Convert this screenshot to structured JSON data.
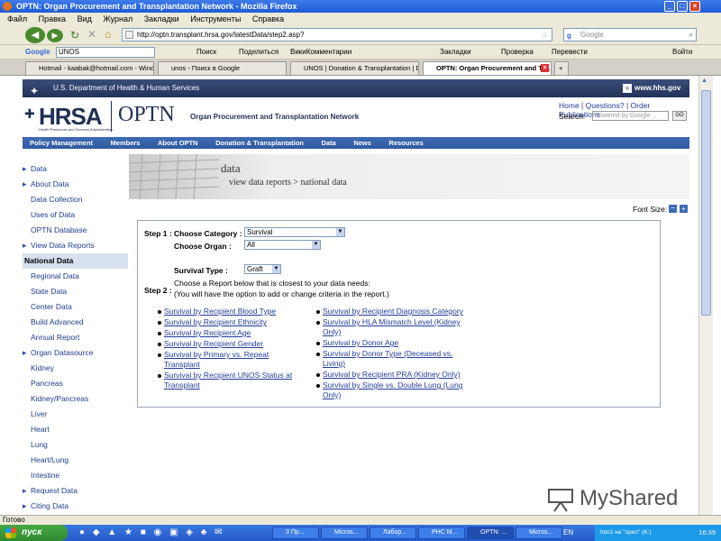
{
  "window": {
    "title": "OPTN: Organ Procurement and Transplantation Network - Mozilla Firefox"
  },
  "menu": [
    "Файл",
    "Правка",
    "Вид",
    "Журнал",
    "Закладки",
    "Инструменты",
    "Справка"
  ],
  "address": {
    "url": "http://optn.transplant.hrsa.gov/latestData/step2.asp?",
    "search_placeholder": "Google"
  },
  "googlebar": {
    "query": "UNOS",
    "items": [
      "Поиск",
      "Поделиться",
      "ВикиКомментарии",
      "Закладки",
      "Проверка",
      "Перевести",
      "Войти"
    ]
  },
  "tabs": [
    {
      "label": "Hotmail - kaabak@hotmail.com - Windo..."
    },
    {
      "label": "unos - Поиск в Google"
    },
    {
      "label": "UNOS | Donation & Transplantation | D..."
    },
    {
      "label": "OPTN: Organ Procurement and Tr..."
    }
  ],
  "hhs": {
    "left": "U.S. Department of Health & Human Services",
    "right": "www.hhs.gov"
  },
  "header": {
    "hrsa": "HRSA",
    "hrsa_sub": "Health Resources and Services Administration",
    "optn": "OPTN",
    "optn_full": "Organ Procurement and Transplantation Network",
    "links": "Home | Questions? | Order Publications",
    "search_label": "Search:",
    "search_placeholder": "Powered by Google",
    "go": "GO"
  },
  "nav": [
    "Policy Management",
    "Members",
    "About OPTN",
    "Donation & Transplantation",
    "Data",
    "News",
    "Resources"
  ],
  "sidebar": [
    {
      "label": "Data",
      "arrow": true
    },
    {
      "label": "About Data",
      "arrow": true
    },
    {
      "label": "Data Collection"
    },
    {
      "label": "Uses of Data"
    },
    {
      "label": "OPTN Database"
    },
    {
      "label": "View Data Reports",
      "arrow": true
    },
    {
      "label": "National Data",
      "head": true
    },
    {
      "label": "Regional Data"
    },
    {
      "label": "State Data"
    },
    {
      "label": "Center Data"
    },
    {
      "label": "Build Advanced"
    },
    {
      "label": "Annual Report"
    },
    {
      "label": "Organ Datasource",
      "arrow": true
    },
    {
      "label": "Kidney"
    },
    {
      "label": "Pancreas"
    },
    {
      "label": "Kidney/Pancreas"
    },
    {
      "label": "Liver"
    },
    {
      "label": "Heart"
    },
    {
      "label": "Lung"
    },
    {
      "label": "Heart/Lung"
    },
    {
      "label": "Intestine"
    },
    {
      "label": "Request Data",
      "arrow": true
    },
    {
      "label": "Citing Data",
      "arrow": true
    }
  ],
  "banner": {
    "title": "data",
    "crumb": "view data reports > national data"
  },
  "font_size_label": "Font Size:",
  "form": {
    "step1": "Step 1 :",
    "choose_category": "Choose Category :",
    "category_value": "Survival",
    "choose_organ": "Choose Organ :",
    "organ_value": "All",
    "survival_type": "Survival Type :",
    "survival_value": "Graft",
    "step2": "Step 2 :",
    "step2_line1": "Choose a Report below that is closest to your data needs:",
    "step2_line2": "(You will have the option to add or change criteria in the report.)"
  },
  "reports_left": [
    [
      "Survival by Recipient Blood Type"
    ],
    [
      "Survival by Recipient Ethnicity"
    ],
    [
      "Survival by Recipient Age"
    ],
    [
      "Survival by Recipient Gender"
    ],
    [
      "Survival by Primary vs. Repeat",
      "Transplant"
    ],
    [
      "Survival by Recipient UNOS Status at",
      "Transplant"
    ]
  ],
  "reports_right": [
    [
      "Survival by Recipient Diagnosis Category"
    ],
    [
      "Survival by HLA Mismatch Level (Kidney",
      "Only)"
    ],
    [
      "Survival by Donor Age"
    ],
    [
      "Survival by Donor Type (Deceased vs.",
      "Living)"
    ],
    [
      "Survival by Recipient PRA (Kidney Only)"
    ],
    [
      "Survival by Single vs. Double Lung (Lung",
      "Only)"
    ]
  ],
  "watermark": "MyShared",
  "status": "Готово",
  "taskbar": {
    "start": "пуск",
    "items": [
      "3 Пр...",
      "Micros...",
      "Лабор...",
      "PHC M...",
      "OPTN: ...",
      "Micros..."
    ],
    "lang": "EN",
    "tray_text": "foto1 на \"open\" (K:)",
    "time": "16:39"
  }
}
